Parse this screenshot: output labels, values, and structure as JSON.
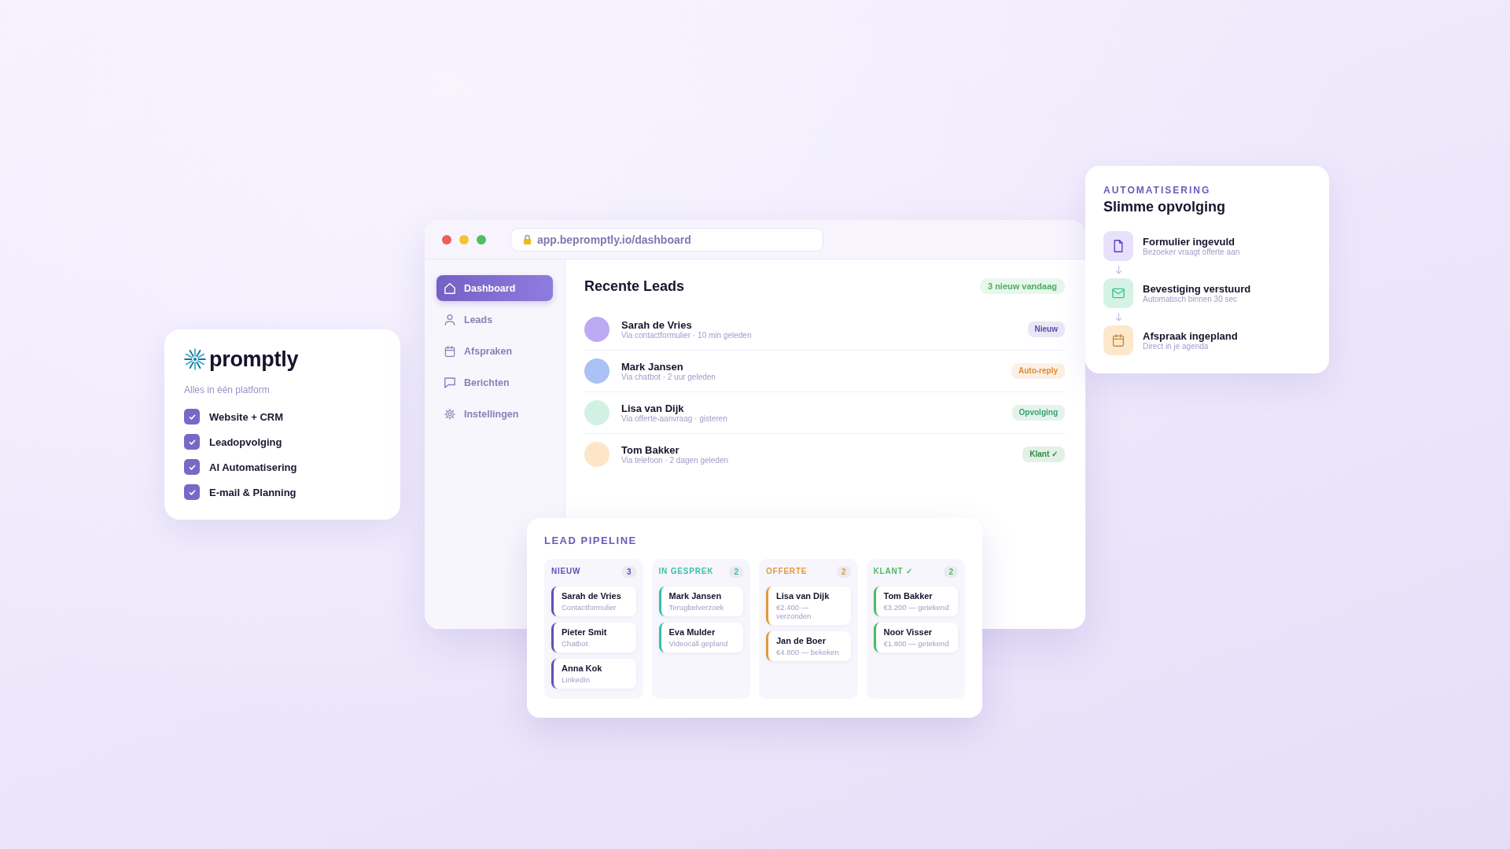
{
  "brand_card": {
    "logo": "promptly",
    "tagline": "Alles in één platform",
    "features": [
      {
        "label": "Website + CRM",
        "checked": true
      },
      {
        "label": "Leadopvolging",
        "checked": true
      },
      {
        "label": "AI Automatisering",
        "checked": true
      },
      {
        "label": "E-mail & Planning",
        "checked": true
      }
    ]
  },
  "browser": {
    "url": "app.bepromptly.io/dashboard",
    "sidebar": {
      "items": [
        {
          "label": "Dashboard",
          "selected": true
        },
        {
          "label": "Leads",
          "selected": false
        },
        {
          "label": "Afspraken",
          "selected": false
        },
        {
          "label": "Berichten",
          "selected": false
        },
        {
          "label": "Instellingen",
          "selected": false
        }
      ]
    },
    "recent_leads": {
      "title": "Recente Leads",
      "badge": "3 nieuw vandaag",
      "rows": [
        {
          "name": "Sarah de Vries",
          "source": "Via contactformulier · 10 min geleden",
          "color": "#bcaaf3",
          "tag": {
            "label": "Nieuw",
            "color": "#5a4ab0"
          }
        },
        {
          "name": "Mark Jansen",
          "source": "Via chatbot · 2 uur geleden",
          "color": "#a9c1f4",
          "tag": {
            "label": "Auto-reply",
            "color": "#df8a2c"
          }
        },
        {
          "name": "Lisa van Dijk",
          "source": "Via offerte-aanvraag · gisteren",
          "color": "#d2f1e4",
          "tag": {
            "label": "Opvolging",
            "color": "#36a46a"
          }
        },
        {
          "name": "Tom Bakker",
          "source": "Via telefoon · 2 dagen geleden",
          "color": "#fde5c8",
          "tag": {
            "label": "Klant ✓",
            "color": "#2a8a3c"
          }
        }
      ]
    }
  },
  "pipeline": {
    "title": "LEAD PIPELINE",
    "columns": [
      {
        "title": "NIEUW",
        "count": "3",
        "color": "#5e51b6",
        "cards": [
          {
            "name": "Sarah de Vries",
            "detail": "Contactformulier"
          },
          {
            "name": "Pieter Smit",
            "detail": "Chatbot"
          },
          {
            "name": "Anna Kok",
            "detail": "LinkedIn"
          }
        ]
      },
      {
        "title": "IN GESPREK",
        "count": "2",
        "color": "#38bfaa",
        "cards": [
          {
            "name": "Mark Jansen",
            "detail": "Terugbelverzoek"
          },
          {
            "name": "Eva Mulder",
            "detail": "Videocall gepland"
          }
        ]
      },
      {
        "title": "OFFERTE",
        "count": "2",
        "color": "#e4993c",
        "cards": [
          {
            "name": "Lisa van Dijk",
            "detail": "€2.400 — verzonden"
          },
          {
            "name": "Jan de Boer",
            "detail": "€4.800 — bekeken"
          }
        ]
      },
      {
        "title": "KLANT ✓",
        "count": "2",
        "color": "#4bbb64",
        "cards": [
          {
            "name": "Tom Bakker",
            "detail": "€3.200 — getekend"
          },
          {
            "name": "Noor Visser",
            "detail": "€1.800 — getekend"
          }
        ]
      }
    ]
  },
  "automation": {
    "eyebrow": "AUTOMATISERING",
    "title": "Slimme opvolging",
    "steps": [
      {
        "title": "Formulier ingevuld",
        "detail": "Bezoeker vraagt offerte aan",
        "color": "#e7e1fb"
      },
      {
        "title": "Bevestiging verstuurd",
        "detail": "Automatisch binnen 30 sec",
        "color": "#d5f2e5"
      },
      {
        "title": "Afspraak ingepland",
        "detail": "Direct in je agenda",
        "color": "#fde8cc"
      }
    ]
  }
}
